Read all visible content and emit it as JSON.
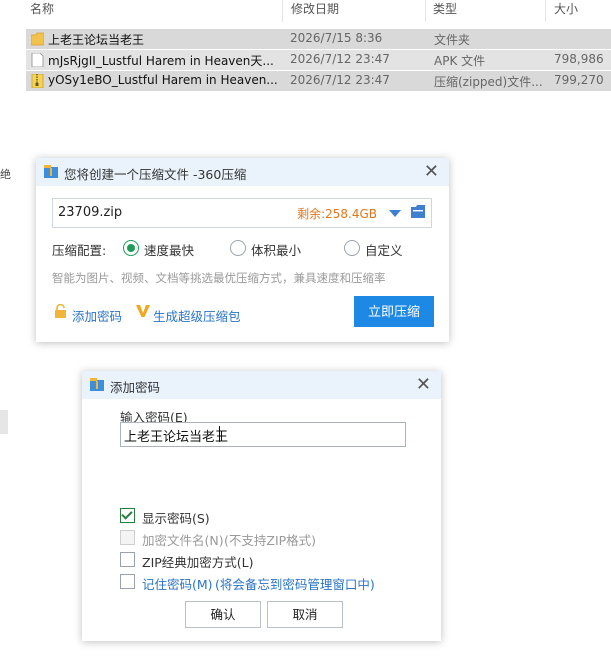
{
  "explorer": {
    "columns": {
      "name": "名称",
      "modified": "修改日期",
      "type": "类型",
      "size": "大小"
    },
    "rows": [
      {
        "name": "上老王论坛当老王",
        "modified": "2026/7/15 8:36",
        "type": "文件夹",
        "size": "",
        "icon": "folder-icon"
      },
      {
        "name": "mJsRjgII_Lustful Harem in Heaven天...",
        "modified": "2026/7/12 23:47",
        "type": "APK 文件",
        "size": "798,986",
        "icon": "file-icon"
      },
      {
        "name": "yOSy1eBO_Lustful Harem in Heaven...",
        "modified": "2026/7/12 23:47",
        "type": "压缩(zipped)文件...",
        "size": "799,270",
        "icon": "zip-icon"
      }
    ],
    "edge_char": "绝"
  },
  "compress_dialog": {
    "title": "您将创建一个压缩文件 -360压缩",
    "path": "23709.zip",
    "free_space": "剩余:258.4GB",
    "config_label": "压缩配置:",
    "options": [
      "速度最快",
      "体积最小",
      "自定义"
    ],
    "selected_option": "速度最快",
    "hint": "智能为图片、视频、文档等挑选最优压缩方式，兼具速度和压缩率",
    "add_password": "添加密码",
    "super_compress": "生成超级压缩包",
    "compress_now": "立即压缩"
  },
  "password_dialog": {
    "title": "添加密码",
    "input_label": "输入密码(E)",
    "password": "上老王论坛当老王",
    "show_password": {
      "label": "显示密码(S)",
      "checked": true
    },
    "encrypt_names": {
      "label": "加密文件名(N)",
      "note": "(不支持ZIP格式)",
      "disabled": true
    },
    "zip_classic": {
      "label": "ZIP经典加密方式(L)",
      "checked": false
    },
    "remember": {
      "label": "记住密码(M)",
      "note": "(将会备忘到密码管理窗口中)",
      "checked": false
    },
    "ok": "确认",
    "cancel": "取消"
  },
  "colors": {
    "accent": "#1e88e5",
    "free_space": "#e0761b",
    "radio_selected": "#1f9b5a",
    "link": "#2a74c6"
  }
}
